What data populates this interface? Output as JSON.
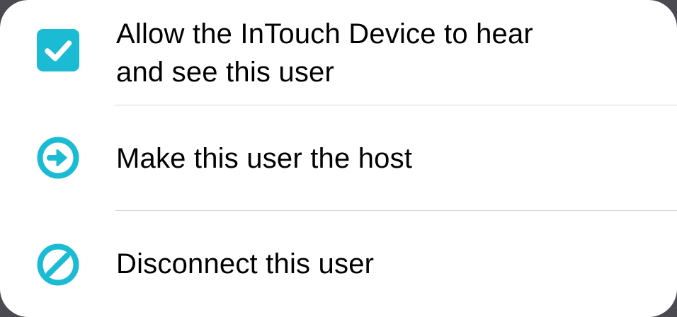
{
  "theme": {
    "accent": "#1bbcd3",
    "background": "#ffffff",
    "backdrop": "#4a4a50",
    "divider": "#d6d6d8",
    "text": "#000000"
  },
  "options": [
    {
      "id": "allow-hear-see",
      "icon": "checkbox-checked-icon",
      "checked": true,
      "label_line1": "Allow the InTouch Device to hear",
      "label_line2": "and see this user"
    },
    {
      "id": "make-host",
      "icon": "arrow-right-circle-icon",
      "label": "Make this user the host"
    },
    {
      "id": "disconnect",
      "icon": "prohibited-circle-icon",
      "label": "Disconnect this user"
    }
  ]
}
